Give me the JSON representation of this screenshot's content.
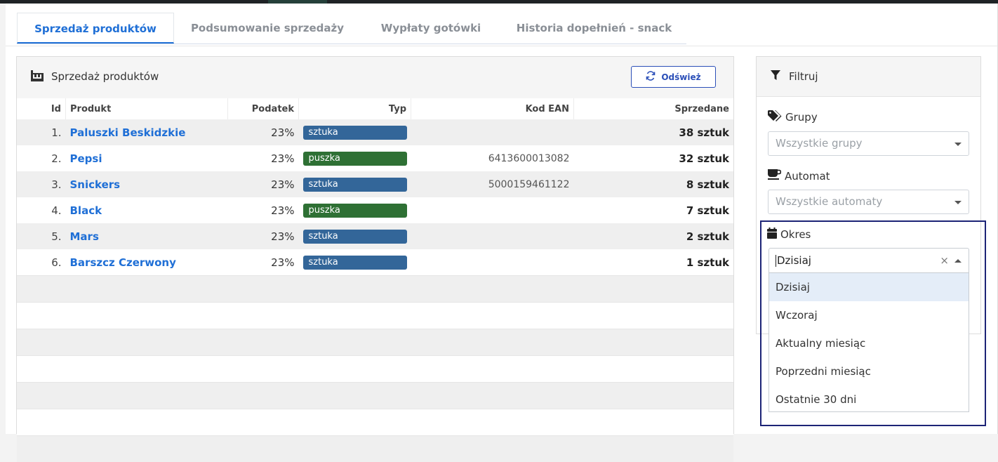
{
  "tabs": [
    {
      "label": "Sprzedaż produktów",
      "active": true
    },
    {
      "label": "Podsumowanie sprzedaży"
    },
    {
      "label": "Wypłaty gotówki"
    },
    {
      "label": "Historia dopełnień - snack"
    }
  ],
  "main": {
    "title": "Sprzedaż produktów",
    "refresh_label": "Odśwież",
    "columns": [
      "Id",
      "Produkt",
      "Podatek",
      "Typ",
      "Kod EAN",
      "Sprzedane"
    ],
    "rows": [
      {
        "id": "1.",
        "name": "Paluszki Beskidzkie",
        "tax": "23%",
        "type": "sztuka",
        "ean": "",
        "sold": "38 sztuk"
      },
      {
        "id": "2.",
        "name": "Pepsi",
        "tax": "23%",
        "type": "puszka",
        "ean": "6413600013082",
        "sold": "32 sztuk"
      },
      {
        "id": "3.",
        "name": "Snickers",
        "tax": "23%",
        "type": "sztuka",
        "ean": "5000159461122",
        "sold": "8 sztuk"
      },
      {
        "id": "4.",
        "name": "Black",
        "tax": "23%",
        "type": "puszka",
        "ean": "",
        "sold": "7 sztuk"
      },
      {
        "id": "5.",
        "name": "Mars",
        "tax": "23%",
        "type": "sztuka",
        "ean": "",
        "sold": "2 sztuk"
      },
      {
        "id": "6.",
        "name": "Barszcz Czerwony",
        "tax": "23%",
        "type": "sztuka",
        "ean": "",
        "sold": "1 sztuk"
      }
    ]
  },
  "filter": {
    "title": "Filtruj",
    "groups_label": "Grupy",
    "groups_placeholder": "Wszystkie grupy",
    "machine_label": "Automat",
    "machine_placeholder": "Wszystkie automaty",
    "period_label": "Okres",
    "period_value": "Dzisiaj",
    "period_options": [
      "Dzisiaj",
      "Wczoraj",
      "Aktualny miesiąc",
      "Poprzedni miesiąc",
      "Ostatnie 30 dni"
    ],
    "clear_symbol": "×"
  },
  "colors": {
    "accent": "#1f6fd6",
    "badge_sztuka": "#336699",
    "badge_puszka": "#2e7034",
    "highlight": "#1c2376"
  }
}
